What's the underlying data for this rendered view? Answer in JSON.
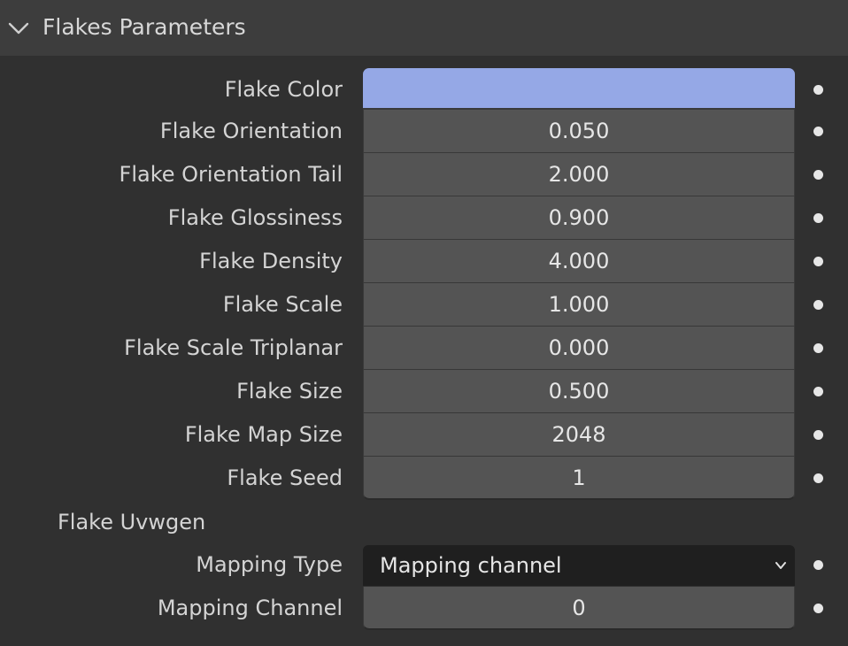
{
  "panel": {
    "title": "Flakes Parameters"
  },
  "rows": [
    {
      "label": "Flake Color",
      "value": "",
      "color": "#95a8e6"
    },
    {
      "label": "Flake Orientation",
      "value": "0.050"
    },
    {
      "label": "Flake Orientation Tail",
      "value": "2.000"
    },
    {
      "label": "Flake Glossiness",
      "value": "0.900"
    },
    {
      "label": "Flake Density",
      "value": "4.000"
    },
    {
      "label": "Flake Scale",
      "value": "1.000"
    },
    {
      "label": "Flake Scale Triplanar",
      "value": "0.000"
    },
    {
      "label": "Flake Size",
      "value": "0.500"
    },
    {
      "label": "Flake Map Size",
      "value": "2048"
    },
    {
      "label": "Flake Seed",
      "value": "1"
    }
  ],
  "uvwgen": {
    "section_label": "Flake Uvwgen",
    "mapping_type_label": "Mapping Type",
    "mapping_type_value": "Mapping channel",
    "mapping_channel_label": "Mapping Channel",
    "mapping_channel_value": "0"
  },
  "colors": {
    "panel_bg": "#303030",
    "header_bg": "#3d3d3d",
    "field_bg": "#545454",
    "dropdown_bg": "#1f1f1f",
    "flake_color": "#95a8e6"
  }
}
